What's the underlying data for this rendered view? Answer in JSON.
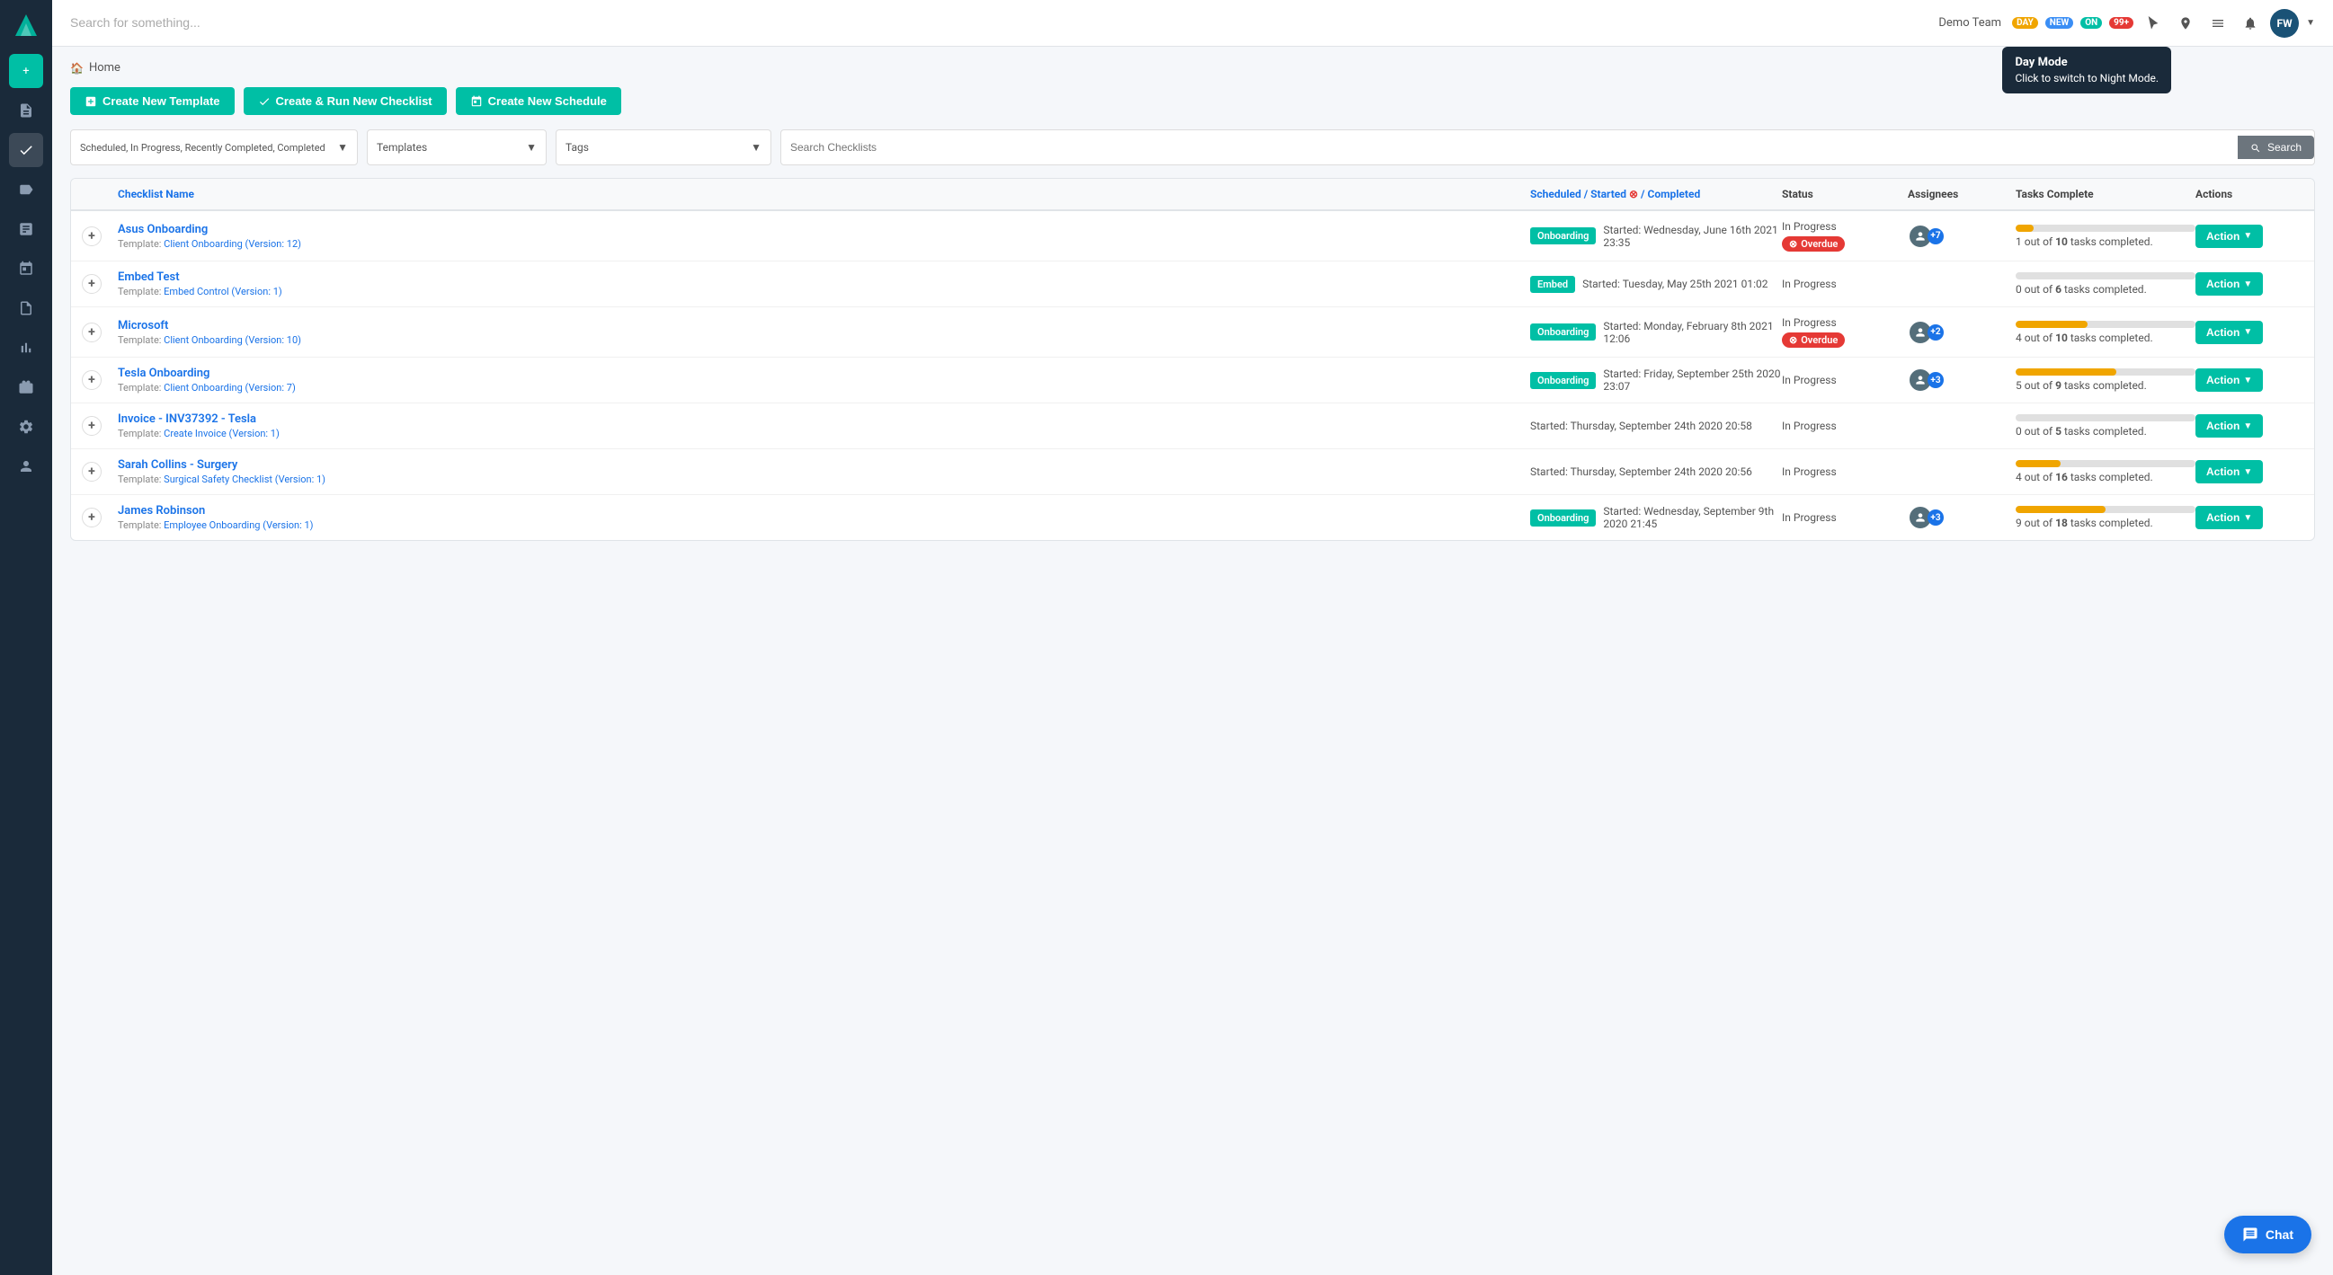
{
  "sidebar": {
    "items": [
      {
        "name": "add",
        "icon": "+",
        "active": false
      },
      {
        "name": "templates",
        "icon": "📄",
        "active": false
      },
      {
        "name": "checklists",
        "icon": "✓",
        "active": true
      },
      {
        "name": "tags",
        "icon": "🏷",
        "active": false
      },
      {
        "name": "reports",
        "icon": "📊",
        "active": false
      },
      {
        "name": "calendar",
        "icon": "📅",
        "active": false
      },
      {
        "name": "audit",
        "icon": "📋",
        "active": false
      },
      {
        "name": "analytics",
        "icon": "📈",
        "active": false
      },
      {
        "name": "jobs",
        "icon": "💼",
        "active": false
      },
      {
        "name": "settings",
        "icon": "🔧",
        "active": false
      },
      {
        "name": "users",
        "icon": "👤",
        "active": false
      }
    ]
  },
  "header": {
    "search_placeholder": "Search for something...",
    "team_name": "Demo Team",
    "badges": {
      "day": "DAY",
      "new": "NEW",
      "on": "ON",
      "count": "99+"
    },
    "avatar_initials": "FW"
  },
  "tooltip": {
    "title": "Day Mode",
    "subtitle": "Click to switch to Night Mode."
  },
  "breadcrumb": {
    "home_label": "Home"
  },
  "buttons": {
    "create_template": "Create New Template",
    "create_checklist": "Create & Run New Checklist",
    "create_schedule": "Create New Schedule"
  },
  "filters": {
    "status_filter": "Scheduled, In Progress, Recently Completed, Completed",
    "templates_filter": "Templates",
    "tags_filter": "Tags",
    "search_placeholder": "Search Checklists",
    "search_btn": "Search"
  },
  "table": {
    "columns": [
      "",
      "Checklist Name",
      "Scheduled / Started  / Completed",
      "Status",
      "Assignees",
      "Tasks Complete",
      "Actions"
    ],
    "rows": [
      {
        "name": "Asus Onboarding",
        "template": "Client Onboarding (Version: 12)",
        "tag": "Onboarding",
        "tag_class": "tag-onboarding",
        "started": "Started: Wednesday, June 16th 2021 23:35",
        "status": "In Progress",
        "overdue": true,
        "assignees": 7,
        "tasks_done": 1,
        "tasks_total": 10,
        "progress_pct": 10
      },
      {
        "name": "Embed Test",
        "template": "Embed Control (Version: 1)",
        "tag": "Embed",
        "tag_class": "tag-embed",
        "started": "Started: Tuesday, May 25th 2021 01:02",
        "status": "In Progress",
        "overdue": false,
        "assignees": 0,
        "tasks_done": 0,
        "tasks_total": 6,
        "progress_pct": 0
      },
      {
        "name": "Microsoft",
        "template": "Client Onboarding (Version: 10)",
        "tag": "Onboarding",
        "tag_class": "tag-onboarding",
        "started": "Started: Monday, February 8th 2021 12:06",
        "status": "In Progress",
        "overdue": true,
        "assignees": 2,
        "tasks_done": 4,
        "tasks_total": 10,
        "progress_pct": 40
      },
      {
        "name": "Tesla Onboarding",
        "template": "Client Onboarding (Version: 7)",
        "tag": "Onboarding",
        "tag_class": "tag-onboarding",
        "started": "Started: Friday, September 25th 2020 23:07",
        "status": "In Progress",
        "overdue": false,
        "assignees": 3,
        "tasks_done": 5,
        "tasks_total": 9,
        "progress_pct": 56
      },
      {
        "name": "Invoice - INV37392 - Tesla",
        "template": "Create Invoice (Version: 1)",
        "tag": null,
        "tag_class": "",
        "started": "Started: Thursday, September 24th 2020 20:58",
        "status": "In Progress",
        "overdue": false,
        "assignees": 0,
        "tasks_done": 0,
        "tasks_total": 5,
        "progress_pct": 0
      },
      {
        "name": "Sarah Collins - Surgery",
        "template": "Surgical Safety Checklist (Version: 1)",
        "tag": null,
        "tag_class": "",
        "started": "Started: Thursday, September 24th 2020 20:56",
        "status": "In Progress",
        "overdue": false,
        "assignees": 0,
        "tasks_done": 4,
        "tasks_total": 16,
        "progress_pct": 25
      },
      {
        "name": "James Robinson",
        "template": "Employee Onboarding (Version: 1)",
        "tag": "Onboarding",
        "tag_class": "tag-onboarding",
        "started": "Started: Wednesday, September 9th 2020 21:45",
        "status": "In Progress",
        "overdue": false,
        "assignees": 3,
        "tasks_done": 9,
        "tasks_total": 18,
        "progress_pct": 50
      }
    ],
    "action_label": "Action"
  },
  "chat": {
    "label": "Chat"
  }
}
